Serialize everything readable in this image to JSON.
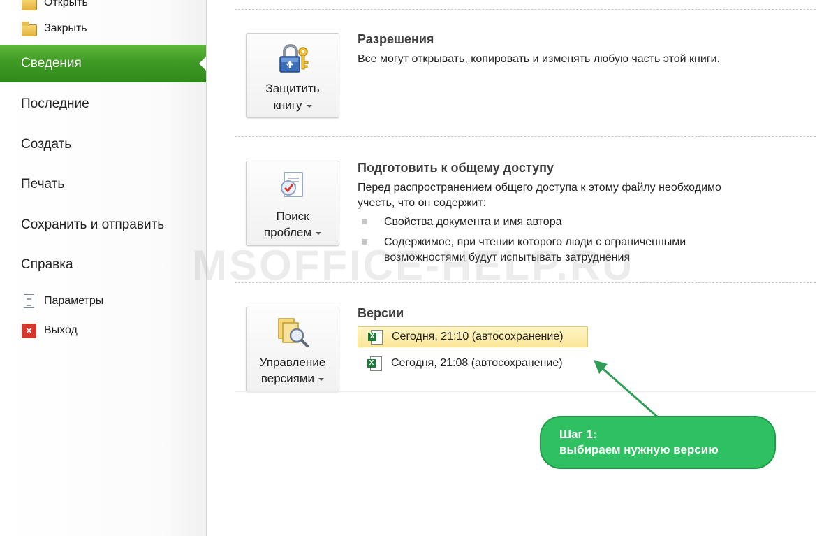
{
  "nav": {
    "open_label": "Открыть",
    "close_label": "Закрыть",
    "info_label": "Сведения",
    "recent_label": "Последние",
    "new_label": "Создать",
    "print_label": "Печать",
    "save_send_label": "Сохранить и отправить",
    "help_label": "Справка",
    "options_label": "Параметры",
    "exit_label": "Выход"
  },
  "permissions": {
    "button_line1": "Защитить",
    "button_line2": "книгу",
    "title": "Разрешения",
    "text": "Все могут открывать, копировать и изменять любую часть этой книги."
  },
  "prepare": {
    "button_line1": "Поиск",
    "button_line2": "проблем",
    "title": "Подготовить к общему доступу",
    "text_line1": "Перед распространением общего доступа к этому файлу необходимо",
    "text_line2": "учесть, что он содержит:",
    "bullet1": "Свойства документа и имя автора",
    "bullet2_line1": "Содержимое, при чтении которого люди с ограниченными",
    "bullet2_line2": "возможностями будут испытывать затруднения"
  },
  "versions": {
    "button_line1": "Управление",
    "button_line2": "версиями",
    "title": "Версии",
    "items": [
      {
        "label": "Сегодня, 21:10 (автосохранение)",
        "selected": true
      },
      {
        "label": "Сегодня, 21:08 (автосохранение)",
        "selected": false
      }
    ]
  },
  "watermark": "MSOFFICE-HELP.RU",
  "callout": {
    "line1": "Шаг 1:",
    "line2": "выбираем нужную версию"
  },
  "colors": {
    "active_nav": "#3f9a25",
    "callout_bg": "#2fc062",
    "callout_arrow": "#2e9e55",
    "selected_version": "#fbe69a"
  }
}
